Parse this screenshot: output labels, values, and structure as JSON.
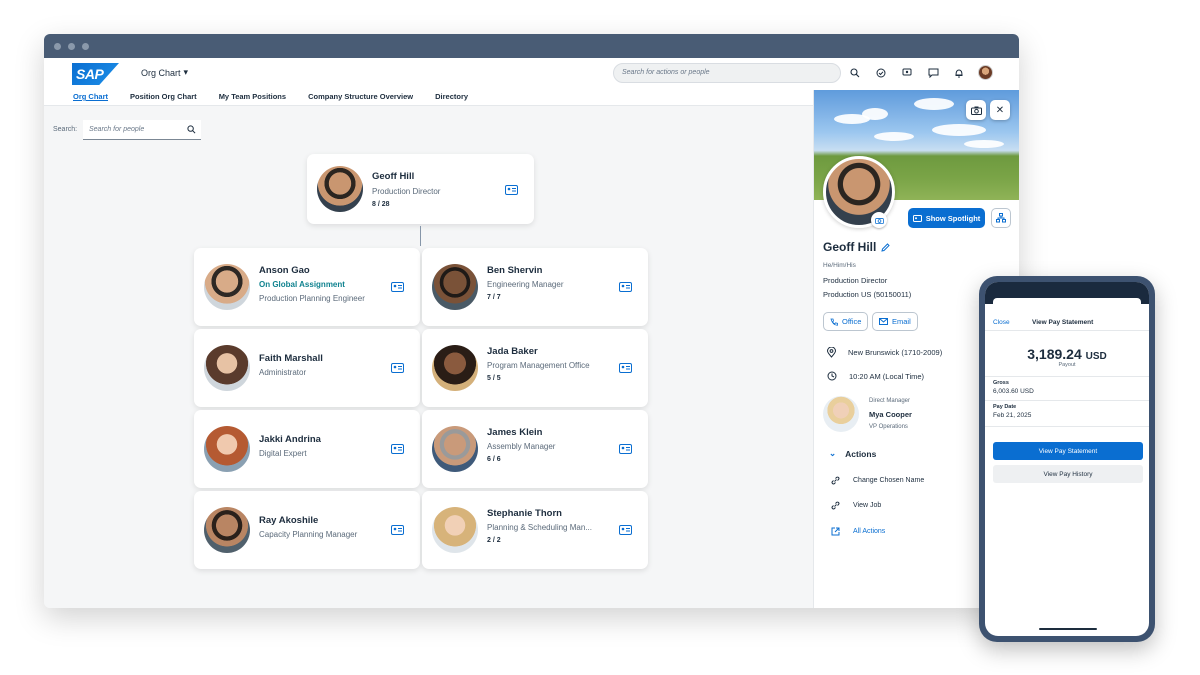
{
  "app": {
    "logo_text": "SAP",
    "title": "Org Chart"
  },
  "shell": {
    "search_placeholder": "Search for actions or people"
  },
  "tabs": [
    "Org Chart",
    "Position Org Chart",
    "My Team Positions",
    "Company Structure Overview",
    "Directory"
  ],
  "search": {
    "label": "Search:",
    "placeholder": "Search for people"
  },
  "root": {
    "name": "Geoff Hill",
    "title": "Production Director",
    "count": "8 / 28"
  },
  "reports": [
    {
      "name": "Anson Gao",
      "status": "On Global Assignment",
      "title": "Production Planning Engineer",
      "count": ""
    },
    {
      "name": "Ben Shervin",
      "status": "",
      "title": "Engineering Manager",
      "count": "7 / 7"
    },
    {
      "name": "Faith Marshall",
      "status": "",
      "title": "Administrator",
      "count": ""
    },
    {
      "name": "Jada Baker",
      "status": "",
      "title": "Program Management Office",
      "count": "5 / 5"
    },
    {
      "name": "Jakki Andrina",
      "status": "",
      "title": "Digital Expert",
      "count": ""
    },
    {
      "name": "James Klein",
      "status": "",
      "title": "Assembly Manager",
      "count": "6 / 6"
    },
    {
      "name": "Ray Akoshile",
      "status": "",
      "title": "Capacity Planning Manager",
      "count": ""
    },
    {
      "name": "Stephanie Thorn",
      "status": "",
      "title": "Planning & Scheduling Man...",
      "count": "2 / 2"
    }
  ],
  "profile": {
    "name": "Geoff Hill",
    "pronouns": "He/Him/His",
    "title": "Production Director",
    "department": "Production US (50150011)",
    "spotlight_label": "Show Spotlight",
    "office_label": "Office",
    "email_label": "Email",
    "location": "New Brunswick (1710-2009)",
    "local_time": "10:20 AM (Local Time)",
    "manager_label": "Direct Manager",
    "manager_name": "Mya Cooper",
    "manager_title": "VP Operations",
    "actions_heading": "Actions",
    "actions": [
      "Change Chosen Name",
      "View Job",
      "All Actions"
    ]
  },
  "phone": {
    "close": "Close",
    "title": "View Pay Statement",
    "amount": "3,189.24",
    "currency": "USD",
    "payout_label": "Payout",
    "gross_label": "Gross",
    "gross_value": "6,003.60 USD",
    "pay_date_label": "Pay Date",
    "pay_date_value": "Feb 21, 2025",
    "primary_button": "View Pay Statement",
    "secondary_button": "View Pay History"
  },
  "colors": {
    "brand": "#0a6ed1",
    "assignment": "#0f828f",
    "chrome": "#495c75"
  }
}
